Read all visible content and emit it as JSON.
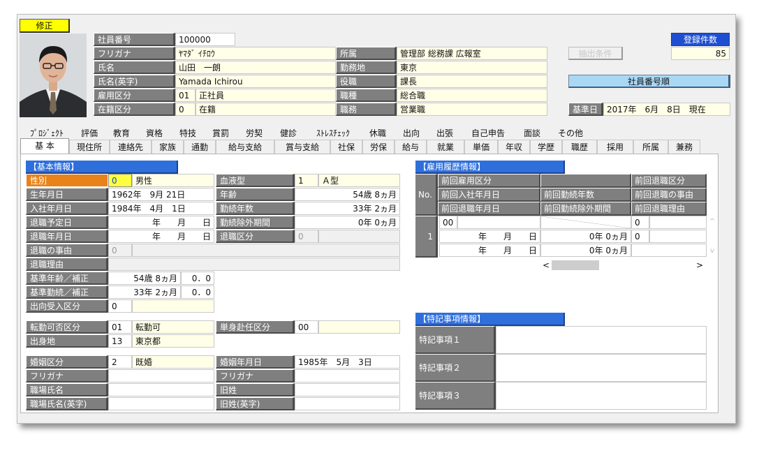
{
  "mode_button": "修正",
  "employee": {
    "id_label": "社員番号",
    "id": "100000",
    "kana_label": "フリガナ",
    "kana": "ﾔﾏﾀﾞ ｲﾁﾛｳ",
    "name_label": "氏名",
    "name": "山田　一朗",
    "name_en_label": "氏名(英字)",
    "name_en": "Yamada Ichirou",
    "emp_type_label": "雇用区分",
    "emp_type_code": "01",
    "emp_type": "正社員",
    "status_label": "在籍区分",
    "status_code": "0",
    "status": "在籍",
    "dept_label": "所属",
    "dept": "管理部 総務課 広報室",
    "office_label": "勤務地",
    "office": "東京",
    "position_label": "役職",
    "position": "課長",
    "jobtype_label": "職種",
    "jobtype": "総合職",
    "duty_label": "職務",
    "duty": "営業職"
  },
  "right": {
    "count_label": "登録件数",
    "count": "85",
    "cond_button": "抽出条件",
    "sort_button": "社員番号順",
    "base_label": "基準日",
    "base_date": "2017年　6月　8日　現在"
  },
  "tabs_row1": [
    "ﾌﾟﾛｼﾞｪｸﾄ",
    "評価",
    "教育",
    "資格",
    "特技",
    "賞罰",
    "労契",
    "健診",
    "ｽﾄﾚｽﾁｪｯｸ",
    "休職",
    "出向",
    "出張",
    "自己申告",
    "面談",
    "その他"
  ],
  "tabs_row2": [
    "基 本",
    "現住所",
    "連絡先",
    "家族",
    "通勤",
    "給与支給",
    "賞与支給",
    "社保",
    "労保",
    "給与",
    "就業",
    "単価",
    "年収",
    "学歴",
    "職歴",
    "採用",
    "所属",
    "兼務"
  ],
  "basic": {
    "title": "【基本情報】",
    "sex_label": "性別",
    "sex_code": "0",
    "sex": "男性",
    "blood_label": "血液型",
    "blood_code": "1",
    "blood": "Ａ型",
    "birth_label": "生年月日",
    "birth": "1962年　9月 21日",
    "age_label": "年齢",
    "age": "54歳 8ヵ月",
    "join_label": "入社年月日",
    "join": "1984年　4月　1日",
    "tenure_label": "勤続年数",
    "tenure": "33年 2ヵ月",
    "plan_retire_label": "退職予定日",
    "plan_retire": "年　　月　　日",
    "excl_label": "勤続除外期間",
    "excl": "0年 0ヵ月",
    "retire_label": "退職年月日",
    "retire": "年　　月　　日",
    "retire_type_label": "退職区分",
    "retire_type_code": "0",
    "reason_label": "退職の事由",
    "reason_code": "0",
    "reason_text_label": "退職理由",
    "base_age_label": "基準年齢／補正",
    "base_age": "54歳 8ヵ月",
    "base_age_adj": "0．0",
    "base_ten_label": "基準勤続／補正",
    "base_ten": "33年 2ヵ月",
    "base_ten_adj": "0．0",
    "second_label": "出向受入区分",
    "second_code": "0",
    "transfer_label": "転勤可否区分",
    "transfer_code": "01",
    "transfer": "転勤可",
    "single_label": "単身赴任区分",
    "single_code": "00",
    "origin_label": "出身地",
    "origin_code": "13",
    "origin": "東京都",
    "marital_label": "婚姻区分",
    "marital_code": "2",
    "marital": "既婚",
    "marry_date_label": "婚姻年月日",
    "marry_date": "1985年　5月　3日",
    "kana1_label": "フリガナ",
    "kana2_label": "フリガナ",
    "work_name_label": "職場氏名",
    "old_name_label": "旧姓",
    "work_name_en_label": "職場氏名(英字)",
    "old_name_en_label": "旧姓(英字)"
  },
  "history": {
    "title": "【雇用履歴情報】",
    "no_label": "No.",
    "h1": "前回雇用区分",
    "h2": "前回退職区分",
    "h3": "前回入社年月日",
    "h4": "前回勤続年数",
    "h5": "前回退職の事由",
    "h6": "前回退職年月日",
    "h7": "前回勤続除外期間",
    "h8": "前回退職理由",
    "row_no": "1",
    "emp_code": "00",
    "retire_code": "0",
    "reason_code": "0",
    "join": "年　　月　　日",
    "retire": "年　　月　　日",
    "tenure": "0年 0ヵ月",
    "excl": "0年 0ヵ月",
    "scroll_left": "<",
    "scroll_right": ">",
    "scroll_up": "^",
    "scroll_down": "v"
  },
  "notes": {
    "title": "【特記事項情報】",
    "n1": "特記事項１",
    "n2": "特記事項２",
    "n3": "特記事項３"
  }
}
